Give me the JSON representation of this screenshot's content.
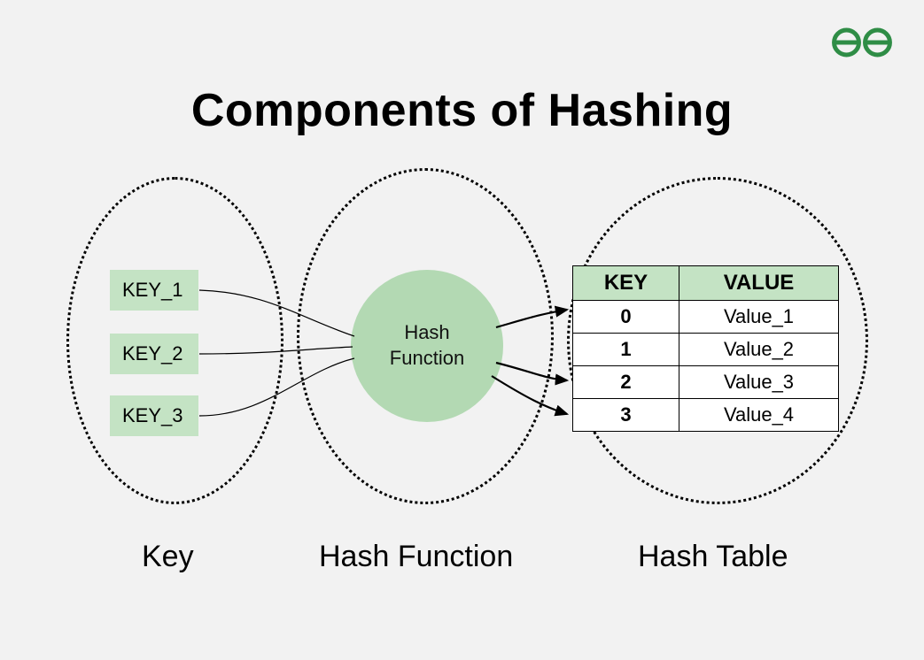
{
  "title": "Components of Hashing",
  "brand_color": "#2f8d46",
  "keys_section": {
    "label": "Key",
    "items": [
      "KEY_1",
      "KEY_2",
      "KEY_3"
    ]
  },
  "hash_function_section": {
    "label": "Hash Function",
    "circle_text": "Hash\nFunction"
  },
  "hash_table_section": {
    "label": "Hash Table",
    "header_key": "KEY",
    "header_value": "VALUE",
    "rows": [
      {
        "key": "0",
        "value": "Value_1"
      },
      {
        "key": "1",
        "value": "Value_2"
      },
      {
        "key": "2",
        "value": "Value_3"
      },
      {
        "key": "3",
        "value": "Value_4"
      }
    ]
  }
}
